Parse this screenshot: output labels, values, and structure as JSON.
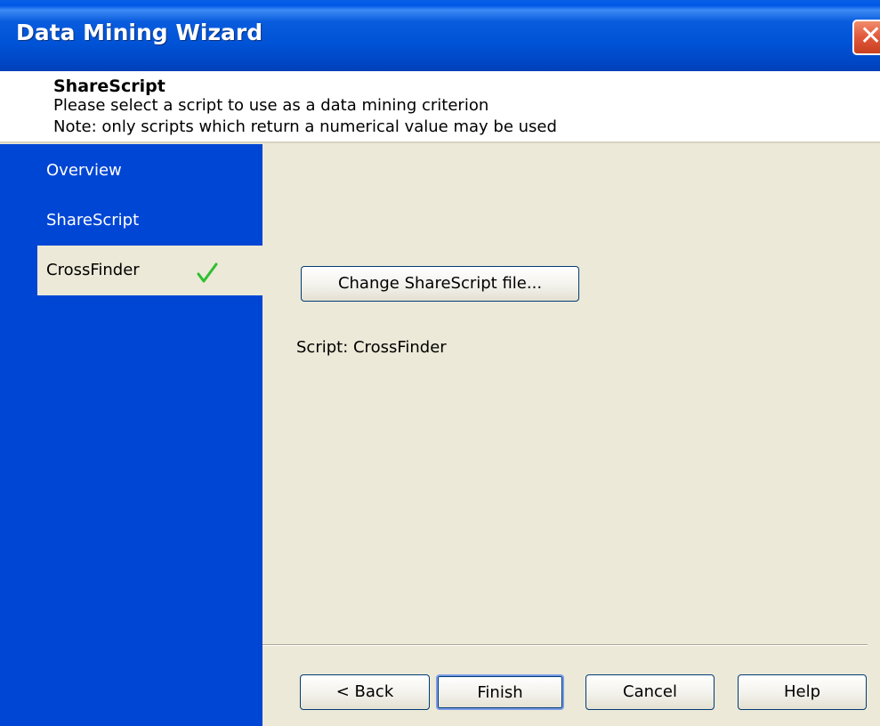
{
  "window": {
    "title": "Data Mining Wizard",
    "close_label": "✕"
  },
  "header": {
    "heading": "ShareScript",
    "line1": "Please select a script to use as a data mining criterion",
    "line2": "Note: only scripts which return a numerical value may be used"
  },
  "sidebar": {
    "items": [
      {
        "label": "Overview",
        "selected": false
      },
      {
        "label": "ShareScript",
        "selected": false
      },
      {
        "label": "CrossFinder",
        "selected": true,
        "icon": "checkmark-icon"
      }
    ]
  },
  "content": {
    "change_button_label": "Change ShareScript file...",
    "script_label": "Script: CrossFinder"
  },
  "buttons": {
    "back": "< Back",
    "finish": "Finish",
    "cancel": "Cancel",
    "help": "Help"
  },
  "colors": {
    "titlebar": "#0053d6",
    "sidebar": "#0046d5",
    "panel": "#ece9d8",
    "check": "#2fbf2f"
  }
}
